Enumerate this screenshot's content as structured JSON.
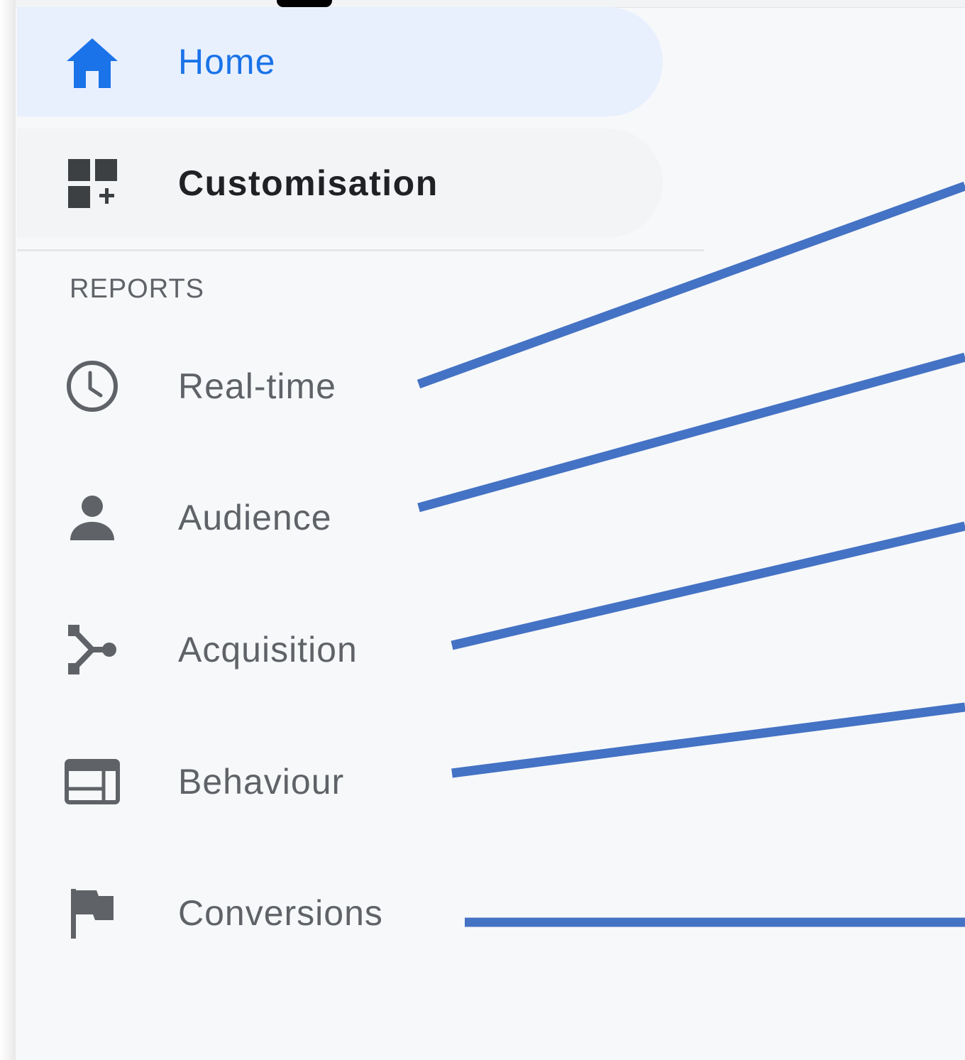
{
  "nav": {
    "home": {
      "label": "Home",
      "icon": "home-icon",
      "active": true
    },
    "customisation": {
      "label": "Customisation",
      "icon": "dashboard-add-icon"
    }
  },
  "reports": {
    "title": "REPORTS",
    "items": [
      {
        "label": "Real-time",
        "icon": "clock-icon"
      },
      {
        "label": "Audience",
        "icon": "person-icon"
      },
      {
        "label": "Acquisition",
        "icon": "merge-icon"
      },
      {
        "label": "Behaviour",
        "icon": "behaviour-window-icon"
      },
      {
        "label": "Conversions",
        "icon": "flag-icon"
      }
    ]
  },
  "colors": {
    "active_blue": "#1a73e8",
    "active_background": "#e8f0fe",
    "icon_gray": "#5f6368",
    "annotation_line": "#4472c4",
    "sidebar_background": "#f7f8fa"
  }
}
